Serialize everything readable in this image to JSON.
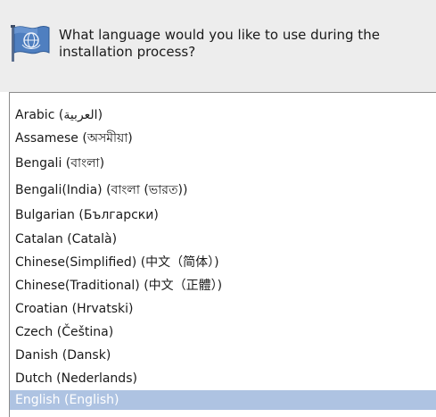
{
  "prompt": "What language would you like to use during the installation process?",
  "icon": "flag-globe-icon",
  "colors": {
    "header_bg": "#ededed",
    "selection_bg": "#aec3e2",
    "selection_text": "#ffffff",
    "text": "#1a1a1a"
  },
  "languages": [
    {
      "label": "Arabic (العربية)",
      "selected": false
    },
    {
      "label": "Assamese (অসমীয়া)",
      "selected": false
    },
    {
      "label": "Bengali (বাংলা)",
      "selected": false
    },
    {
      "label": "Bengali(India) (বাংলা (ভারত))",
      "selected": false
    },
    {
      "label": "Bulgarian (Български)",
      "selected": false
    },
    {
      "label": "Catalan (Català)",
      "selected": false
    },
    {
      "label": "Chinese(Simplified) (中文（简体）)",
      "selected": false
    },
    {
      "label": "Chinese(Traditional) (中文（正體）)",
      "selected": false
    },
    {
      "label": "Croatian (Hrvatski)",
      "selected": false
    },
    {
      "label": "Czech (Čeština)",
      "selected": false
    },
    {
      "label": "Danish (Dansk)",
      "selected": false
    },
    {
      "label": "Dutch (Nederlands)",
      "selected": false
    },
    {
      "label": "English (English)",
      "selected": true
    }
  ]
}
